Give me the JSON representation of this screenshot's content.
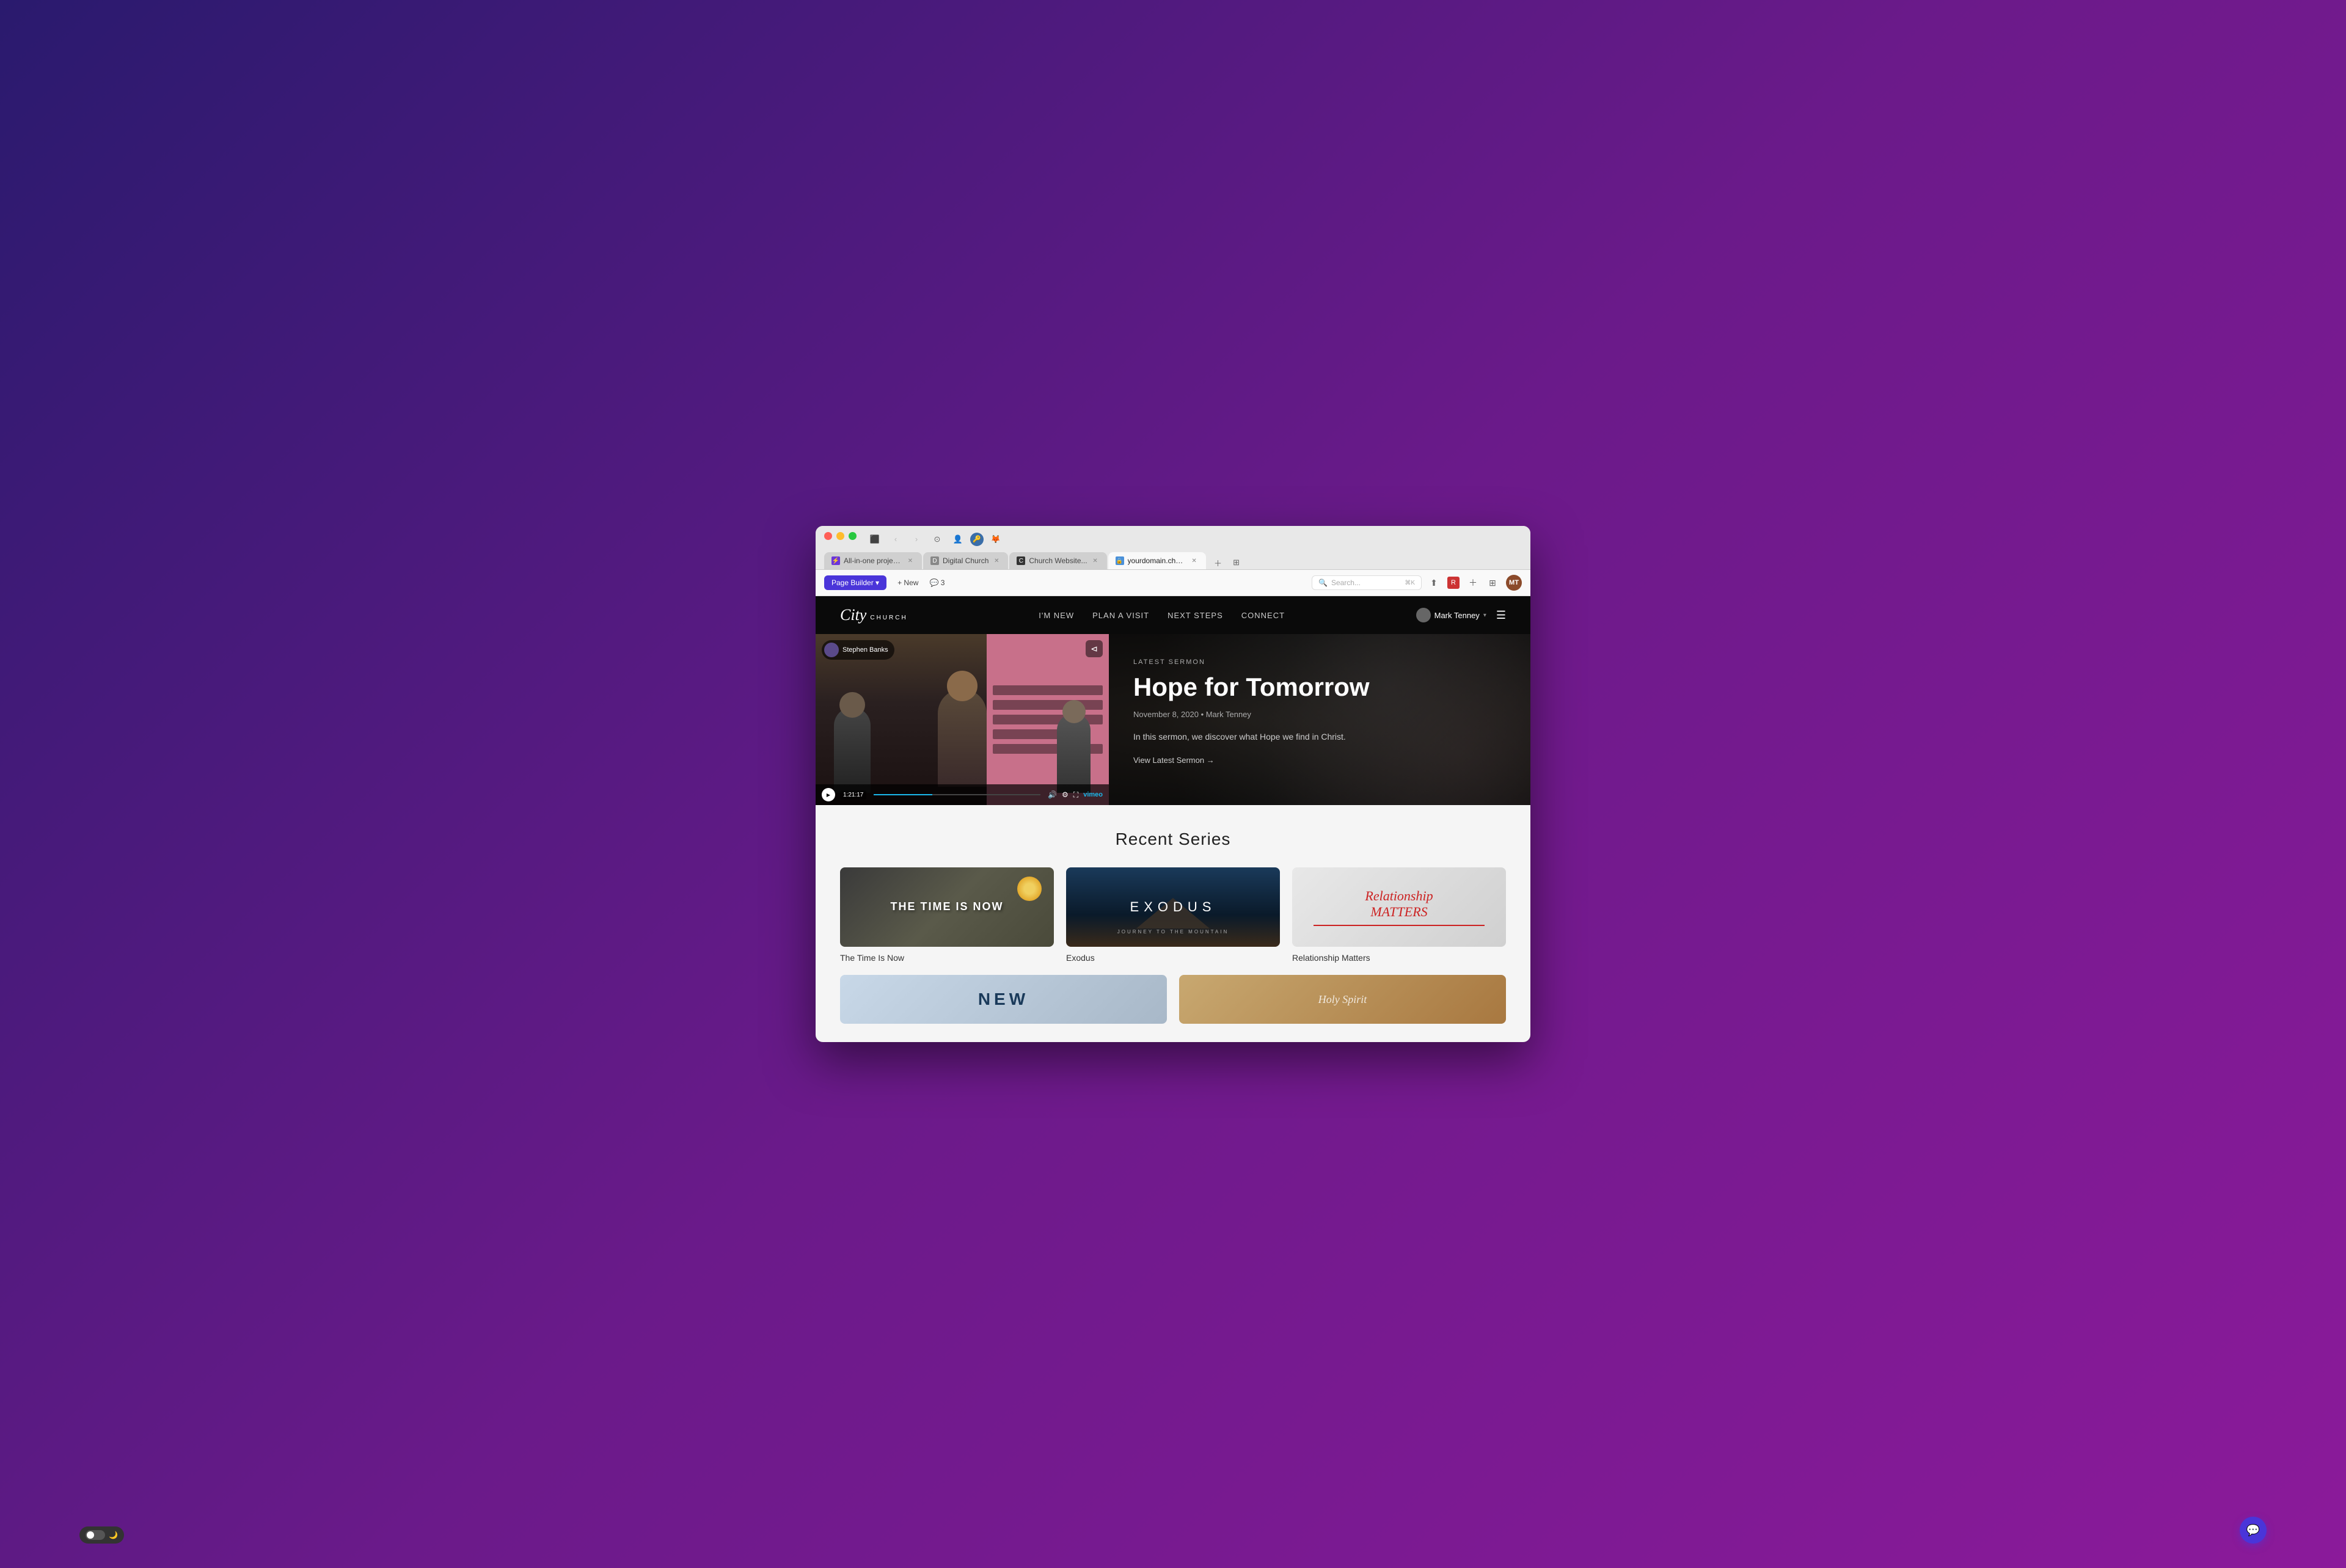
{
  "browser": {
    "tabs": [
      {
        "id": "tab1",
        "label": "All-in-one project...",
        "favicon_type": "purple",
        "favicon_char": "⚡",
        "active": false
      },
      {
        "id": "tab2",
        "label": "Digital Church",
        "favicon_type": "gray",
        "favicon_char": "D",
        "active": false
      },
      {
        "id": "tab3",
        "label": "Church Website...",
        "favicon_type": "dark",
        "favicon_char": "C",
        "active": false
      },
      {
        "id": "tab4",
        "label": "yourdomain.church",
        "favicon_type": "blue",
        "favicon_char": "🔒",
        "active": true
      }
    ],
    "url": "yourdomain.church",
    "url_lock_icon": "🔒"
  },
  "toolbar": {
    "page_builder_label": "Page Builder ▾",
    "new_label": "+ New",
    "comments_label": "💬 3",
    "search_placeholder": "Search...",
    "search_shortcut": "⌘K"
  },
  "site": {
    "logo_city": "City",
    "logo_church": "CHURCH",
    "nav_links": [
      {
        "id": "im-new",
        "label": "I'M NEW"
      },
      {
        "id": "plan-a-visit",
        "label": "PLAN A VISIT"
      },
      {
        "id": "next-steps",
        "label": "NEXT STEPS"
      },
      {
        "id": "connect",
        "label": "CONNECT"
      }
    ],
    "user_name": "Mark Tenney"
  },
  "hero": {
    "latest_sermon_label": "LATEST SERMON",
    "sermon_title": "Hope for Tomorrow",
    "sermon_meta": "November 8, 2020 • Mark Tenney",
    "sermon_description": "In this sermon, we discover what Hope we find in Christ.",
    "sermon_link": "View Latest Sermon →",
    "video": {
      "speaker_name": "Stephen Banks",
      "duration": "1:21:17",
      "vimeo_label": "vimeo"
    }
  },
  "recent_series": {
    "section_title": "Recent Series",
    "series": [
      {
        "id": "time-is-now",
        "title": "The Time Is Now",
        "thumb_text": "THE TIME IS NOW"
      },
      {
        "id": "exodus",
        "title": "Exodus",
        "thumb_text": "EXODUS",
        "sub_text": "JOURNEY TO THE MOUNTAIN"
      },
      {
        "id": "relationship-matters",
        "title": "Relationship Matters",
        "thumb_line1": "Relationship",
        "thumb_line2": "MATTERS"
      }
    ],
    "series_row2": [
      {
        "id": "new",
        "title": "NEW",
        "thumb_text": "NEW"
      },
      {
        "id": "holy-spirit",
        "title": "Holy Spirit",
        "thumb_text": "Holy Spirit"
      }
    ]
  },
  "ui": {
    "dark_mode_toggle_label": "🌙",
    "chat_icon": "💬",
    "bookmark_icon": "⊲",
    "play_icon": "▶"
  }
}
